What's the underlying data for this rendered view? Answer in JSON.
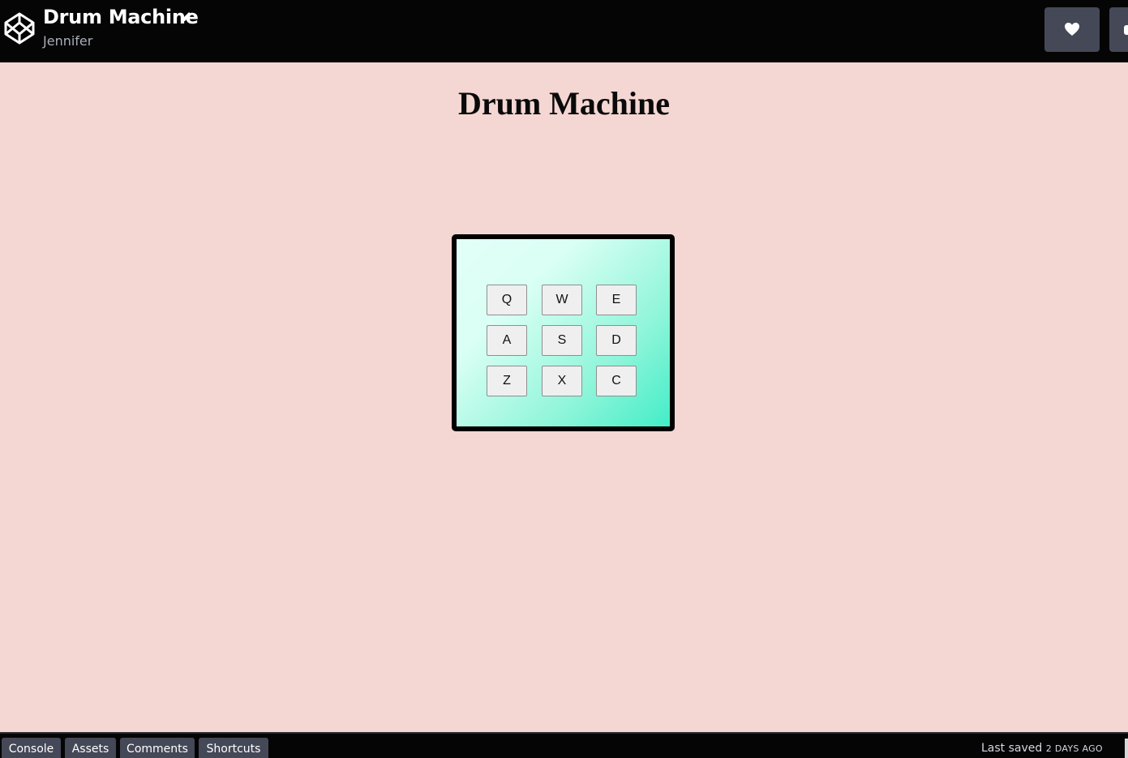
{
  "header": {
    "pen_title": "Drum Machine",
    "author": "Jennifer",
    "icons": [
      "codepen-logo-icon",
      "pencil-icon",
      "heart-icon"
    ]
  },
  "preview": {
    "heading": "Drum Machine",
    "pads": [
      "Q",
      "W",
      "E",
      "A",
      "S",
      "D",
      "Z",
      "X",
      "C"
    ],
    "colors": {
      "background": "#f4d6d2",
      "panel_gradient_start": "#e2fff7",
      "panel_gradient_end": "#43edc8",
      "panel_border": "#000000"
    }
  },
  "footer": {
    "tabs": [
      "Console",
      "Assets",
      "Comments",
      "Shortcuts"
    ],
    "last_saved_label": "Last saved",
    "last_saved_time": "2 DAYS AGO"
  }
}
